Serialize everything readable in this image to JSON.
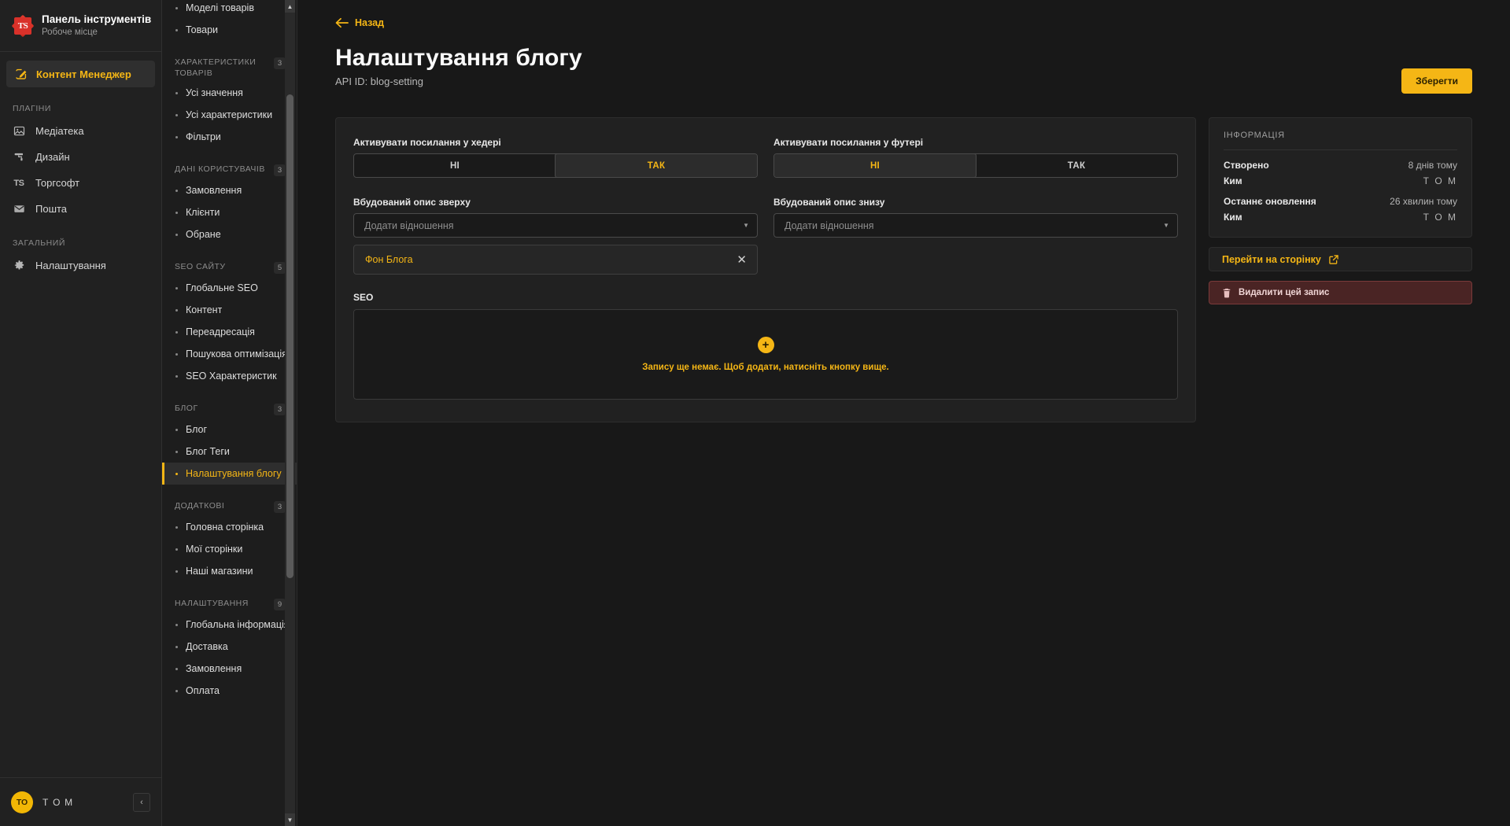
{
  "brand": {
    "logo_text": "TS",
    "title": "Панель інструментів",
    "subtitle": "Робоче місце"
  },
  "left_nav": {
    "active_item": {
      "label": "Контент Менеджер",
      "icon": "pencil-square-icon"
    },
    "groups": [
      {
        "label": "ПЛАГІНИ",
        "items": [
          {
            "label": "Медіатека",
            "icon": "image-icon"
          },
          {
            "label": "Дизайн",
            "icon": "paint-roller-icon"
          },
          {
            "label": "Торгсофт",
            "icon": "ts-icon"
          },
          {
            "label": "Пошта",
            "icon": "envelope-icon"
          }
        ]
      },
      {
        "label": "ЗАГАЛЬНИЙ",
        "items": [
          {
            "label": "Налаштування",
            "icon": "gear-icon"
          }
        ]
      }
    ],
    "footer": {
      "avatar_initials": "ТО",
      "user": "Т О М",
      "collapse_icon": "chevron-left-icon"
    }
  },
  "content_types": {
    "top_items": [
      {
        "label": "Моделі товарів",
        "selected": false
      },
      {
        "label": "Товари",
        "selected": false
      }
    ],
    "groups": [
      {
        "label": "ХАРАКТЕРИСТИКИ ТОВАРІВ",
        "badge": "3",
        "items": [
          {
            "label": "Усі значення",
            "selected": false
          },
          {
            "label": "Усі характеристики",
            "selected": false
          },
          {
            "label": "Фільтри",
            "selected": false
          }
        ]
      },
      {
        "label": "ДАНІ КОРИСТУВАЧІВ",
        "badge": "3",
        "items": [
          {
            "label": "Замовлення",
            "selected": false
          },
          {
            "label": "Клієнти",
            "selected": false
          },
          {
            "label": "Обране",
            "selected": false
          }
        ]
      },
      {
        "label": "SEO САЙТУ",
        "badge": "5",
        "items": [
          {
            "label": "Глобальне SEO",
            "selected": false
          },
          {
            "label": "Контент",
            "selected": false
          },
          {
            "label": "Переадресація",
            "selected": false
          },
          {
            "label": "Пошукова оптимізація",
            "selected": false
          },
          {
            "label": "SEO Характеристик",
            "selected": false
          }
        ]
      },
      {
        "label": "БЛОГ",
        "badge": "3",
        "items": [
          {
            "label": "Блог",
            "selected": false
          },
          {
            "label": "Блог Теги",
            "selected": false
          },
          {
            "label": "Налаштування блогу",
            "selected": true
          }
        ]
      },
      {
        "label": "ДОДАТКОВІ",
        "badge": "3",
        "items": [
          {
            "label": "Головна сторінка",
            "selected": false
          },
          {
            "label": "Мої сторінки",
            "selected": false
          },
          {
            "label": "Наші магазини",
            "selected": false
          }
        ]
      },
      {
        "label": "НАЛАШТУВАННЯ",
        "badge": "9",
        "items": [
          {
            "label": "Глобальна інформація",
            "selected": false
          },
          {
            "label": "Доставка",
            "selected": false
          },
          {
            "label": "Замовлення",
            "selected": false
          },
          {
            "label": "Оплата",
            "selected": false
          }
        ]
      }
    ]
  },
  "header": {
    "back_label": "Назад",
    "back_icon": "arrow-left-icon",
    "title": "Налаштування блогу",
    "api_id": "API ID: blog-setting",
    "save_label": "Зберегти"
  },
  "form": {
    "header_links": {
      "label": "Активувати посилання у хедері",
      "options": [
        "НІ",
        "ТАК"
      ],
      "selected": "ТАК"
    },
    "footer_links": {
      "label": "Активувати посилання у футері",
      "options": [
        "НІ",
        "ТАК"
      ],
      "selected": "НІ"
    },
    "desc_top": {
      "label": "Вбудований опис зверху",
      "placeholder": "Додати відношення",
      "chip": {
        "label": "Фон Блога",
        "remove_icon": "close-icon"
      }
    },
    "desc_bottom": {
      "label": "Вбудований опис знизу",
      "placeholder": "Додати відношення"
    },
    "seo": {
      "label": "SEO",
      "add_icon": "plus-icon",
      "empty_text": "Запису ще немає. Щоб додати, натисніть кнопку вище."
    }
  },
  "info_panel": {
    "heading": "ІНФОРМАЦІЯ",
    "rows": [
      {
        "key": "Створено",
        "value": "8 днів тому"
      },
      {
        "key": "Ким",
        "value": "Т О М"
      },
      {
        "key": "Останнє оновлення",
        "value": "26 хвилин тому"
      },
      {
        "key": "Ким",
        "value": "Т О М"
      }
    ],
    "goto_label": "Перейти на сторінку",
    "goto_icon": "external-link-icon",
    "delete_label": "Видалити цей запис",
    "delete_icon": "trash-icon"
  },
  "colors": {
    "accent": "#f5b615",
    "bg": "#181818",
    "panel": "#212121",
    "danger": "#4a2424"
  }
}
